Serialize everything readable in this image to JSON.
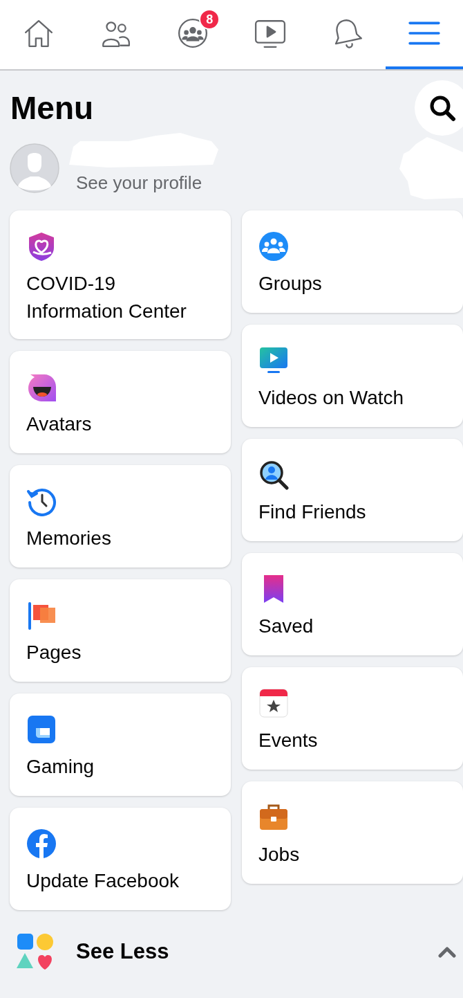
{
  "tabs": [
    {
      "selected": false
    },
    {
      "selected": false
    },
    {
      "selected": false,
      "badge": "8"
    },
    {
      "selected": false
    },
    {
      "selected": false
    },
    {
      "selected": true
    }
  ],
  "title": "Menu",
  "profile": {
    "subtitle": "See your profile"
  },
  "shortcuts_left": [
    {
      "label": "COVID-19 Information Center"
    },
    {
      "label": "Avatars"
    },
    {
      "label": "Memories"
    },
    {
      "label": "Pages"
    },
    {
      "label": "Gaming"
    },
    {
      "label": "Update Facebook"
    }
  ],
  "shortcuts_right": [
    {
      "label": "Groups"
    },
    {
      "label": "Videos on Watch"
    },
    {
      "label": "Find Friends"
    },
    {
      "label": "Saved"
    },
    {
      "label": "Events"
    },
    {
      "label": "Jobs"
    }
  ],
  "see_less": {
    "label": "See Less",
    "expanded": true
  }
}
